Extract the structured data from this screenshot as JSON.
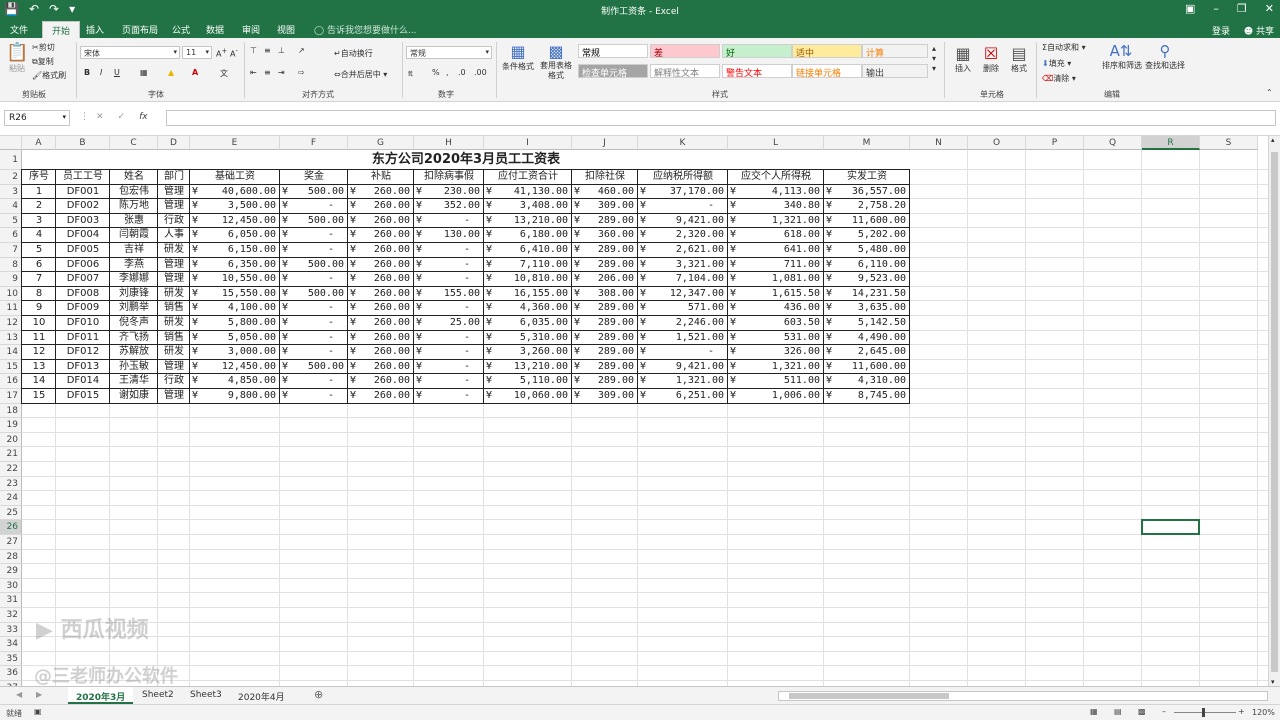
{
  "titlebar": {
    "title": "制作工资条 - Excel",
    "login": "登录",
    "share": "共享"
  },
  "tabs": [
    "文件",
    "开始",
    "插入",
    "页面布局",
    "公式",
    "数据",
    "审阅",
    "视图"
  ],
  "tell_me": "告诉我您想要做什么...",
  "ribbon": {
    "clipboard": {
      "paste": "粘贴",
      "cut": "剪切",
      "copy": "复制",
      "format_painter": "格式刷",
      "label": "剪贴板"
    },
    "font": {
      "name": "宋体",
      "size": "11",
      "label": "字体"
    },
    "alignment": {
      "wrap": "自动换行",
      "merge": "合并后居中",
      "label": "对齐方式"
    },
    "number": {
      "format": "常规",
      "label": "数字"
    },
    "styles": {
      "conditional": "条件格式",
      "table": "套用表格格式",
      "label": "样式",
      "cells": [
        {
          "text": "常规",
          "bg": "#ffffff",
          "color": "#000000"
        },
        {
          "text": "差",
          "bg": "#ffc7ce",
          "color": "#9c0006"
        },
        {
          "text": "好",
          "bg": "#c6efce",
          "color": "#006100"
        },
        {
          "text": "适中",
          "bg": "#ffeb9c",
          "color": "#9c5700"
        },
        {
          "text": "计算",
          "bg": "#f2f2f2",
          "color": "#fa7d00"
        },
        {
          "text": "检查单元格",
          "bg": "#a5a5a5",
          "color": "#ffffff"
        },
        {
          "text": "解释性文本",
          "bg": "#ffffff",
          "color": "#7f7f7f"
        },
        {
          "text": "警告文本",
          "bg": "#ffffff",
          "color": "#ff0000"
        },
        {
          "text": "链接单元格",
          "bg": "#ffffff",
          "color": "#fa7d00"
        },
        {
          "text": "输出",
          "bg": "#f2f2f2",
          "color": "#3f3f3f"
        }
      ]
    },
    "cells": {
      "insert": "插入",
      "delete": "删除",
      "format": "格式",
      "label": "单元格"
    },
    "editing": {
      "autosum": "自动求和",
      "fill": "填充",
      "clear": "清除",
      "sort": "排序和筛选",
      "find": "查找和选择",
      "label": "编辑"
    }
  },
  "name_box": "R26",
  "columns": [
    "A",
    "B",
    "C",
    "D",
    "E",
    "F",
    "G",
    "H",
    "I",
    "J",
    "K",
    "L",
    "M",
    "N",
    "O",
    "P",
    "Q",
    "R",
    "S"
  ],
  "selected_column": "R",
  "selected_row": 26,
  "sheet": {
    "title": "东方公司2020年3月员工工资表",
    "headers": [
      "序号",
      "员工工号",
      "姓名",
      "部门",
      "基础工资",
      "奖金",
      "补贴",
      "扣除病事假",
      "应付工资合计",
      "扣除社保",
      "应纳税所得额",
      "应交个人所得税",
      "实发工资"
    ],
    "rows": [
      [
        "1",
        "DF001",
        "包宏伟",
        "管理",
        "40,600.00",
        "500.00",
        "260.00",
        "230.00",
        "41,130.00",
        "460.00",
        "37,170.00",
        "4,113.00",
        "36,557.00"
      ],
      [
        "2",
        "DF002",
        "陈万地",
        "管理",
        "3,500.00",
        "-",
        "260.00",
        "352.00",
        "3,408.00",
        "309.00",
        "-",
        "340.80",
        "2,758.20"
      ],
      [
        "3",
        "DF003",
        "张惠",
        "行政",
        "12,450.00",
        "500.00",
        "260.00",
        "-",
        "13,210.00",
        "289.00",
        "9,421.00",
        "1,321.00",
        "11,600.00"
      ],
      [
        "4",
        "DF004",
        "闫朝霞",
        "人事",
        "6,050.00",
        "-",
        "260.00",
        "130.00",
        "6,180.00",
        "360.00",
        "2,320.00",
        "618.00",
        "5,202.00"
      ],
      [
        "5",
        "DF005",
        "吉祥",
        "研发",
        "6,150.00",
        "-",
        "260.00",
        "-",
        "6,410.00",
        "289.00",
        "2,621.00",
        "641.00",
        "5,480.00"
      ],
      [
        "6",
        "DF006",
        "李燕",
        "管理",
        "6,350.00",
        "500.00",
        "260.00",
        "-",
        "7,110.00",
        "289.00",
        "3,321.00",
        "711.00",
        "6,110.00"
      ],
      [
        "7",
        "DF007",
        "李娜娜",
        "管理",
        "10,550.00",
        "-",
        "260.00",
        "-",
        "10,810.00",
        "206.00",
        "7,104.00",
        "1,081.00",
        "9,523.00"
      ],
      [
        "8",
        "DF008",
        "刘康锋",
        "研发",
        "15,550.00",
        "500.00",
        "260.00",
        "155.00",
        "16,155.00",
        "308.00",
        "12,347.00",
        "1,615.50",
        "14,231.50"
      ],
      [
        "9",
        "DF009",
        "刘鹏举",
        "销售",
        "4,100.00",
        "-",
        "260.00",
        "-",
        "4,360.00",
        "289.00",
        "571.00",
        "436.00",
        "3,635.00"
      ],
      [
        "10",
        "DF010",
        "倪冬声",
        "研发",
        "5,800.00",
        "-",
        "260.00",
        "25.00",
        "6,035.00",
        "289.00",
        "2,246.00",
        "603.50",
        "5,142.50"
      ],
      [
        "11",
        "DF011",
        "齐飞扬",
        "销售",
        "5,050.00",
        "-",
        "260.00",
        "-",
        "5,310.00",
        "289.00",
        "1,521.00",
        "531.00",
        "4,490.00"
      ],
      [
        "12",
        "DF012",
        "苏解放",
        "研发",
        "3,000.00",
        "-",
        "260.00",
        "-",
        "3,260.00",
        "289.00",
        "-",
        "326.00",
        "2,645.00"
      ],
      [
        "13",
        "DF013",
        "孙玉敏",
        "管理",
        "12,450.00",
        "500.00",
        "260.00",
        "-",
        "13,210.00",
        "289.00",
        "9,421.00",
        "1,321.00",
        "11,600.00"
      ],
      [
        "14",
        "DF014",
        "王清华",
        "行政",
        "4,850.00",
        "-",
        "260.00",
        "-",
        "5,110.00",
        "289.00",
        "1,321.00",
        "511.00",
        "4,310.00"
      ],
      [
        "15",
        "DF015",
        "谢如康",
        "管理",
        "9,800.00",
        "-",
        "260.00",
        "-",
        "10,060.00",
        "309.00",
        "6,251.00",
        "1,006.00",
        "8,745.00"
      ]
    ]
  },
  "currency_symbol": "¥",
  "sheet_tabs": [
    "2020年3月",
    "Sheet2",
    "Sheet3",
    "2020年4月"
  ],
  "active_sheet": "2020年3月",
  "status": {
    "ready": "就绪",
    "zoom": "120%"
  },
  "watermark": {
    "line1": "西瓜视频",
    "line2": "@三老师办公软件"
  }
}
